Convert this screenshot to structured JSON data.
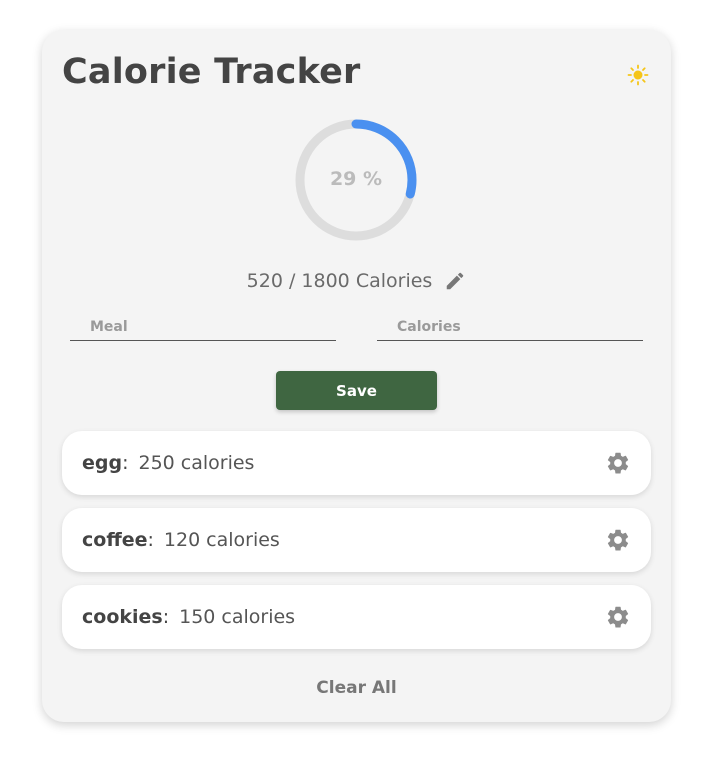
{
  "app": {
    "title": "Calorie Tracker",
    "theme_icon": "sun-icon"
  },
  "progress": {
    "percent_value": 29,
    "percent_label": "29 %",
    "colors": {
      "track": "#dddddd",
      "fill": "#4a90f0",
      "text": "#bbbbbb"
    }
  },
  "totals": {
    "consumed": "520",
    "separator": " / ",
    "goal": "1800",
    "unit": "Calories",
    "edit_icon": "pencil-icon"
  },
  "form": {
    "meal_placeholder": "Meal",
    "meal_value": "",
    "calories_placeholder": "Calories",
    "calories_value": "",
    "save_label": "Save",
    "save_color": "#3f6641"
  },
  "meals": [
    {
      "name": "egg",
      "calories": "250",
      "unit": "calories",
      "icon": "gear-icon"
    },
    {
      "name": "coffee",
      "calories": "120",
      "unit": "calories",
      "icon": "gear-icon"
    },
    {
      "name": "cookies",
      "calories": "150",
      "unit": "calories",
      "icon": "gear-icon"
    }
  ],
  "clear_label": "Clear All",
  "colors": {
    "card_bg": "#f4f4f4",
    "sun": "#f5c518",
    "gear": "#8c8c8c"
  }
}
